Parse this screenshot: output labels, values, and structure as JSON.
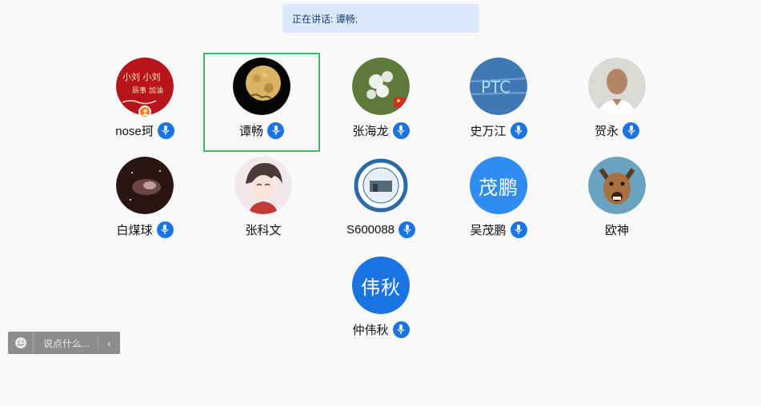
{
  "banner": {
    "text": "正在讲话: 谭畅;"
  },
  "participants": [
    {
      "name": "nose珂",
      "avatar": "photo",
      "mic": "on",
      "host_badge": true
    },
    {
      "name": "谭畅",
      "avatar": "photo",
      "mic": "speaking",
      "active": true
    },
    {
      "name": "张海龙",
      "avatar": "photo",
      "mic": "on"
    },
    {
      "name": "史万江",
      "avatar": "photo",
      "mic": "on"
    },
    {
      "name": "贺永",
      "avatar": "photo",
      "mic": "on"
    },
    {
      "name": "白煤球",
      "avatar": "photo",
      "mic": "on"
    },
    {
      "name": "张科文",
      "avatar": "photo",
      "mic": "none"
    },
    {
      "name": "S600088",
      "avatar": "photo",
      "mic": "on"
    },
    {
      "name": "吴茂鹏",
      "avatar_text": "茂鹏",
      "avatar_color": "#2f8cf0",
      "mic": "on"
    },
    {
      "name": "欧神",
      "avatar": "photo",
      "mic": "none"
    },
    {
      "name": "仲伟秋",
      "avatar_text": "伟秋",
      "avatar_color": "#1b74e4",
      "mic": "on"
    }
  ],
  "chat": {
    "placeholder": "说点什么..."
  },
  "colors": {
    "accent": "#1b74e4",
    "active_border": "#2ec06a",
    "banner_bg": "#d9e8fb"
  }
}
